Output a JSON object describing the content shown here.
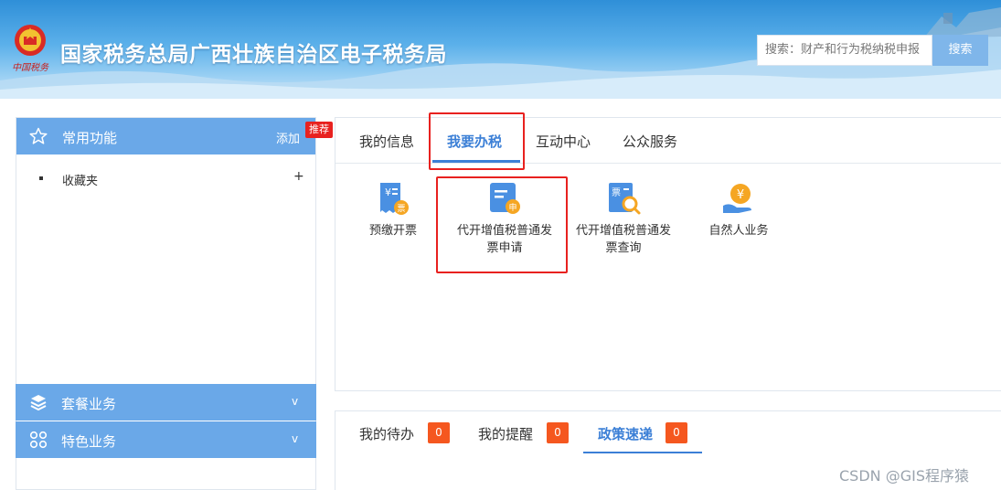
{
  "header": {
    "title": "国家税务总局广西壮族自治区电子税务局",
    "emblem_text": "中国税务",
    "search_placeholder": "搜索：财产和行为税纳税申报",
    "search_button": "搜索"
  },
  "sidebar": {
    "common_title": "常用功能",
    "add_label": "添加",
    "recommend_badge": "推荐",
    "favorites_label": "收藏夹",
    "favorites_add": "+",
    "sections": [
      {
        "label": "套餐业务",
        "chevron": "v"
      },
      {
        "label": "特色业务",
        "chevron": "v"
      }
    ]
  },
  "main": {
    "tabs": [
      {
        "label": "我的信息"
      },
      {
        "label": "我要办税",
        "active": true
      },
      {
        "label": "互动中心"
      },
      {
        "label": "公众服务"
      }
    ],
    "apps": [
      {
        "label": "预缴开票",
        "icon": "invoice-ticket-icon"
      },
      {
        "label": "代开增值税普通发票申请",
        "icon": "apply-invoice-icon"
      },
      {
        "label": "代开增值税普通发票查询",
        "icon": "search-invoice-icon"
      },
      {
        "label": "自然人业务",
        "icon": "yuan-hand-icon"
      }
    ]
  },
  "bottom": {
    "tabs": [
      {
        "label": "我的待办",
        "count": "0"
      },
      {
        "label": "我的提醒",
        "count": "0"
      },
      {
        "label": "政策速递",
        "count": "0",
        "active": true
      }
    ]
  },
  "watermark": "CSDN @GIS程序猿",
  "colors": {
    "accent": "#3b7fd6",
    "sidebar_header": "#6aa8e8",
    "highlight_box": "#e8211f",
    "count_badge": "#f5571f"
  }
}
